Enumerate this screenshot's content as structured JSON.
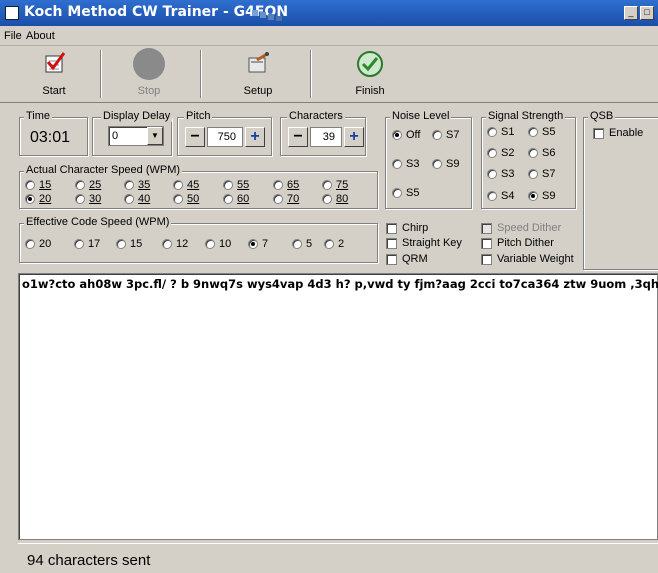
{
  "window": {
    "title": "Koch Method CW Trainer - G4FON"
  },
  "menu": {
    "file": "File",
    "about": "About"
  },
  "toolbar": {
    "start": "Start",
    "stop": "Stop",
    "setup": "Setup",
    "finish": "Finish"
  },
  "time": {
    "label": "Time",
    "value": "03:01"
  },
  "display_delay": {
    "label": "Display Delay",
    "value": "0"
  },
  "pitch": {
    "label": "Pitch",
    "value": "750",
    "minus": "−",
    "plus": "+"
  },
  "characters": {
    "label": "Characters",
    "value": "39",
    "minus": "−",
    "plus": "+"
  },
  "noise": {
    "label": "Noise Level",
    "options": [
      "Off",
      "S7",
      "S3",
      "S9",
      "S5"
    ],
    "selected": "Off"
  },
  "signal": {
    "label": "Signal Strength",
    "options": [
      "S1",
      "S5",
      "S2",
      "S6",
      "S3",
      "S7",
      "S4",
      "S9"
    ],
    "selected": "S9"
  },
  "qsb": {
    "label": "QSB",
    "enable": "Enable"
  },
  "actual_speed": {
    "label": "Actual Character Speed (WPM)",
    "options": [
      "15",
      "25",
      "35",
      "45",
      "55",
      "65",
      "75",
      "20",
      "30",
      "40",
      "50",
      "60",
      "70",
      "80"
    ],
    "selected": "20"
  },
  "effective_speed": {
    "label": "Effective Code Speed (WPM)",
    "options": [
      "20",
      "17",
      "15",
      "12",
      "10",
      "7",
      "5",
      "2"
    ],
    "selected": "7"
  },
  "options": {
    "chirp": "Chirp",
    "straight_key": "Straight Key",
    "qrm": "QRM",
    "speed_dither": "Speed Dither",
    "pitch_dither": "Pitch Dither",
    "variable_weight": "Variable Weight"
  },
  "output": {
    "text": "o1w?cto ah08w 3pc.fl/ ? b 9nwq7s wys4vap 4d3 h? p,vwd ty fjm?aag 2cci to7ca364 ztw 9uom ,3qht"
  },
  "status": {
    "text": "94 characters sent"
  },
  "colors": {
    "title_bar": "#1a4ea8",
    "face": "#d4d0c8"
  }
}
